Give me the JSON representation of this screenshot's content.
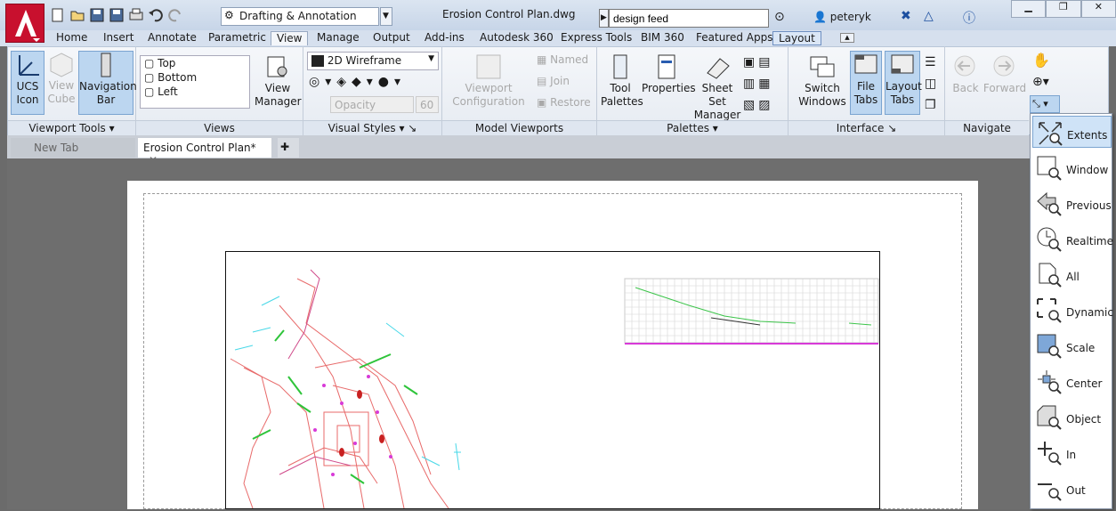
{
  "window": {
    "title": "Erosion Control Plan.dwg",
    "workspace": "Drafting & Annotation",
    "search_value": "design feed",
    "user": "peteryk"
  },
  "ribbon_tabs": [
    "Home",
    "Insert",
    "Annotate",
    "Parametric",
    "View",
    "Manage",
    "Output",
    "Add-ins",
    "Autodesk 360",
    "Express Tools",
    "BIM 360",
    "Featured Apps",
    "Layout"
  ],
  "panels": {
    "viewport_tools": {
      "title": "Viewport Tools",
      "ucs_label": "UCS Icon",
      "viewcube_label": "View Cube",
      "navbar_label": "Navigation Bar"
    },
    "views": {
      "title": "Views",
      "list": [
        "Top",
        "Bottom",
        "Left"
      ],
      "manager_label": "View Manager"
    },
    "visual_styles": {
      "title": "Visual Styles",
      "style_value": "2D Wireframe",
      "opacity_label": "Opacity",
      "opacity_value": "60"
    },
    "model_viewports": {
      "title": "Model Viewports",
      "config_label": "Viewport Configuration",
      "named": "Named",
      "join": "Join",
      "restore": "Restore"
    },
    "palettes": {
      "title": "Palettes",
      "tool_palettes": "Tool Palettes",
      "properties": "Properties",
      "sheet_set": "Sheet Set Manager"
    },
    "interface": {
      "title": "Interface",
      "switch_windows": "Switch Windows",
      "file_tabs": "File Tabs",
      "layout_tabs": "Layout Tabs"
    },
    "navigate": {
      "title": "Navigate",
      "back": "Back",
      "forward": "Forward"
    }
  },
  "doc_tabs": [
    "New Tab",
    "Erosion Control Plan*"
  ],
  "zoom_menu": [
    "Extents",
    "Window",
    "Previous",
    "Realtime",
    "All",
    "Dynamic",
    "Scale",
    "Center",
    "Object",
    "In",
    "Out"
  ]
}
